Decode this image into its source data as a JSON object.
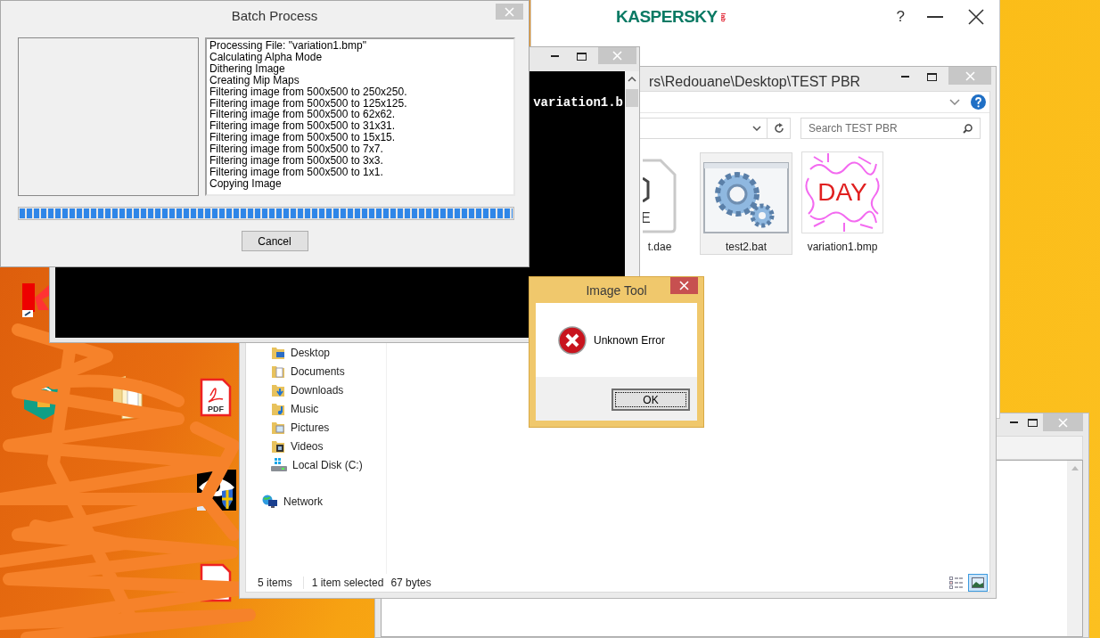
{
  "desktop_icons": [
    {
      "kind": "app"
    },
    {
      "kind": "vpn"
    },
    {
      "kind": "folder"
    },
    {
      "kind": "pdf",
      "badge": "PDF"
    },
    {
      "kind": "eye"
    },
    {
      "kind": "red_doc"
    }
  ],
  "kaspersky_window": {
    "logo": "KASPERSKY",
    "logo_suffix": "lab",
    "help_button": "?"
  },
  "explorer_window": {
    "title": "rs\\Redouane\\Desktop\\TEST PBR",
    "search": {
      "placeholder": "Search TEST PBR"
    },
    "nav_items": [
      {
        "label": "Desktop",
        "kind": "desktop"
      },
      {
        "label": "Documents",
        "kind": "documents"
      },
      {
        "label": "Downloads",
        "kind": "downloads"
      },
      {
        "label": "Music",
        "kind": "music"
      },
      {
        "label": "Pictures",
        "kind": "pictures"
      },
      {
        "label": "Videos",
        "kind": "videos"
      },
      {
        "label": "Local Disk (C:)",
        "kind": "drive"
      }
    ],
    "network_item": {
      "label": "Network"
    },
    "files": [
      {
        "name": "t.dae",
        "kind": "document",
        "type_letter": "E",
        "selected": false
      },
      {
        "name": "test2.bat",
        "kind": "batch",
        "selected": true
      },
      {
        "name": "variation1.bmp",
        "kind": "image",
        "thumbnail_text": "DAY",
        "selected": false
      }
    ],
    "status": {
      "item_count": "5 items",
      "selection": "1 item selected",
      "size": "67 bytes"
    },
    "view_modes": [
      {
        "kind": "details",
        "selected": false
      },
      {
        "kind": "large_icons",
        "selected": true
      }
    ]
  },
  "console_window": {
    "output": "variation1.b"
  },
  "batch_window": {
    "title": "Batch Process",
    "log_lines": [
      "Processing File: \"variation1.bmp\"",
      "Calculating Alpha Mode",
      "Dithering Image",
      "Creating Mip Maps",
      "Filtering image from 500x500 to 250x250.",
      "Filtering image from 500x500 to 125x125.",
      "Filtering image from 500x500 to 62x62.",
      "Filtering image from 500x500 to 31x31.",
      "Filtering image from 500x500 to 15x15.",
      "Filtering image from 500x500 to 7x7.",
      "Filtering image from 500x500 to 3x3.",
      "Filtering image from 500x500 to 1x1.",
      "Copying Image"
    ],
    "progress": {
      "level": 1
    },
    "cancel_button": "Cancel"
  },
  "error_dialog": {
    "title": "Image Tool",
    "message": "Unknown Error",
    "ok_button": "OK"
  }
}
